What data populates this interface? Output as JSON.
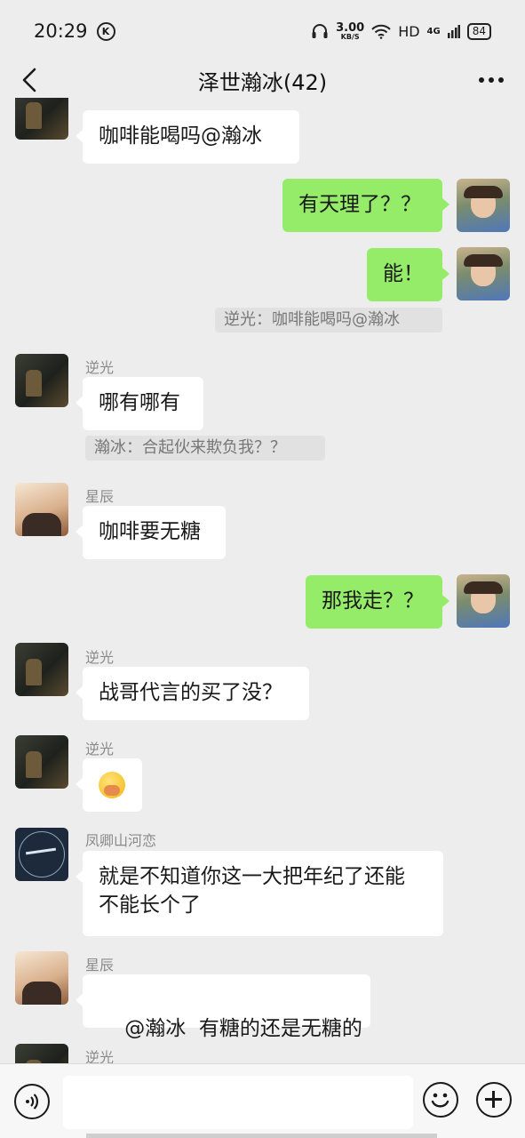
{
  "status_bar": {
    "time": "20:29",
    "k_badge": "K",
    "speed_value": "3.00",
    "speed_unit": "KB/S",
    "hd": "HD",
    "network": "4G",
    "battery": "84",
    "icons": [
      "headphones-icon",
      "wifi-icon",
      "signal-icon",
      "battery-icon"
    ]
  },
  "header": {
    "title": "泽世瀚冰(42)",
    "back_icon": "chevron-left-icon",
    "more_icon": "more-icon"
  },
  "messages": [
    {
      "side": "left",
      "sender": "",
      "text": "咖啡能喝吗@瀚冰"
    },
    {
      "side": "right",
      "text": "有天理了？？"
    },
    {
      "side": "right",
      "text": "能！",
      "quote": "逆光：咖啡能喝吗@瀚冰"
    },
    {
      "side": "left",
      "sender": "逆光",
      "text": "哪有哪有",
      "quote": "瀚冰：合起伙来欺负我？？"
    },
    {
      "side": "left",
      "sender": "星辰",
      "text": "咖啡要无糖"
    },
    {
      "side": "right",
      "text": "那我走？？"
    },
    {
      "side": "left",
      "sender": "逆光",
      "text": "战哥代言的买了没？"
    },
    {
      "side": "left",
      "sender": "逆光",
      "emoji": "laughing-face-emoji"
    },
    {
      "side": "left",
      "sender": "凤卿山河恋",
      "text_line1": "就是不知道你这一大把年纪了还能",
      "text_line2": "不能长个了"
    },
    {
      "side": "left",
      "sender": "星辰",
      "text": "@瀚冰  有糖的还是无糖的"
    },
    {
      "side": "left",
      "sender": "逆光",
      "text": ""
    }
  ],
  "input_bar": {
    "voice_icon": "voice-icon",
    "input_placeholder": "",
    "emoji_icon": "emoji-icon",
    "plus_icon": "plus-icon"
  }
}
